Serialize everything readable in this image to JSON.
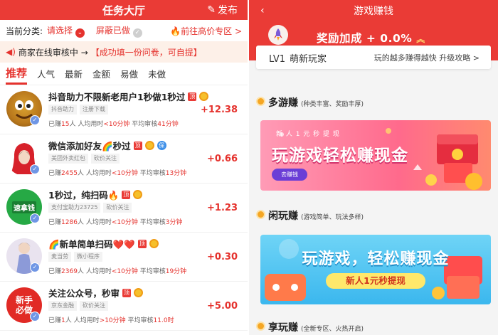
{
  "left": {
    "header": {
      "title": "任务大厅",
      "publish": "发布"
    },
    "category": {
      "label": "当前分类:",
      "select": "请选择",
      "block": "屏蔽已做",
      "zone": "前往高价专区 >"
    },
    "notice": {
      "prefix": "商家在线审核中 →",
      "highlight": "【成功填一份问卷，可自提】"
    },
    "tabs": [
      "推荐",
      "人气",
      "最新",
      "金额",
      "易做",
      "未做"
    ],
    "tasks": [
      {
        "title": "抖音助力不限新老用户1秒做1秒过",
        "chips": [
          "抖音助力",
          "注册下载"
        ],
        "earned": "15",
        "avg": "<10分钟",
        "audit": "41分钟",
        "reward": "+12.38",
        "avatar_text": ""
      },
      {
        "title": "微信添加好友🌈秒过",
        "chips": [
          "美团外卖红包",
          "砍价关注"
        ],
        "earned": "2455",
        "avg": "<10分钟",
        "audit": "13分钟",
        "reward": "+0.66",
        "avatar_text": ""
      },
      {
        "title": "1秒过，纯扫码🔥",
        "chips": [
          "支付宝助力23725",
          "砍价关注"
        ],
        "earned": "1286",
        "avg": "<10分钟",
        "audit": "3分钟",
        "reward": "+1.23",
        "avatar_text": "速拿钱"
      },
      {
        "title": "🌈新单简单扫码❤️❤️",
        "chips": [
          "麦当劳",
          "微小程序"
        ],
        "earned": "2369",
        "avg": "<10分钟",
        "audit": "19分钟",
        "reward": "+0.30",
        "avatar_text": ""
      },
      {
        "title": "关注公众号，秒审",
        "chips": [
          "京东金融",
          "砍价关注"
        ],
        "earned": "1",
        "avg": ">10分钟",
        "audit": "11.0时",
        "reward": "+5.00",
        "avatar_text": "新手必做"
      }
    ],
    "stat_labels": {
      "earned_prefix": "已赚",
      "earned_suffix": "人",
      "avg": "人均用时",
      "audit": "平均审核"
    },
    "tag_text": "顶",
    "bao_text": "保"
  },
  "right": {
    "header": {
      "title": "游戏赚钱"
    },
    "bonus": {
      "text": "奖励加成 + 0.0%",
      "level": "LV1",
      "level_name": "萌新玩家",
      "tip": "玩的越多赚得越快 升级攻略 >"
    },
    "sections": [
      {
        "title": "多游赚",
        "sub": "(种类丰富、奖励丰厚)"
      },
      {
        "title": "闲玩赚",
        "sub": "(游戏简单、玩法多样)"
      },
      {
        "title": "享玩赚",
        "sub": "(全新专区、火热开启)"
      }
    ],
    "banner1": {
      "small": "新 人 1 元 秒 提 现",
      "big": "玩游戏轻松赚现金",
      "btn": "去赚钱"
    },
    "banner2": {
      "big": "玩游戏，轻松赚现金",
      "btn": "新人1元秒提现"
    }
  },
  "colors": {
    "accent": "#ea3b36",
    "reward": "#e5322d",
    "notice_bg": "#fdf0e8"
  }
}
